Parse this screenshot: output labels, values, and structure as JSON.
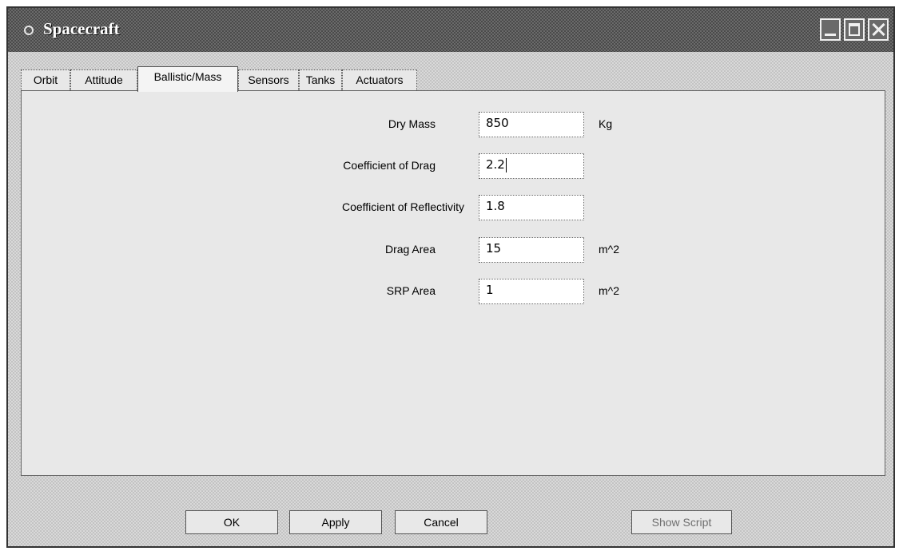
{
  "window": {
    "title": "Spacecraft"
  },
  "tabs": [
    {
      "label": "Orbit"
    },
    {
      "label": "Attitude"
    },
    {
      "label": "Ballistic/Mass",
      "active": true
    },
    {
      "label": "Sensors"
    },
    {
      "label": "Tanks"
    },
    {
      "label": "Actuators"
    }
  ],
  "fields": {
    "dry_mass": {
      "label": "Dry Mass",
      "value": "850",
      "unit": "Kg"
    },
    "coeff_drag": {
      "label": "Coefficient of Drag",
      "value": "2.2",
      "unit": ""
    },
    "coeff_reflectivity": {
      "label": "Coefficient of Reflectivity",
      "value": "1.8",
      "unit": ""
    },
    "drag_area": {
      "label": "Drag Area",
      "value": "15",
      "unit": "m^2"
    },
    "srp_area": {
      "label": "SRP Area",
      "value": "1",
      "unit": "m^2"
    }
  },
  "buttons": {
    "ok": "OK",
    "apply": "Apply",
    "cancel": "Cancel",
    "show_script": "Show Script"
  }
}
